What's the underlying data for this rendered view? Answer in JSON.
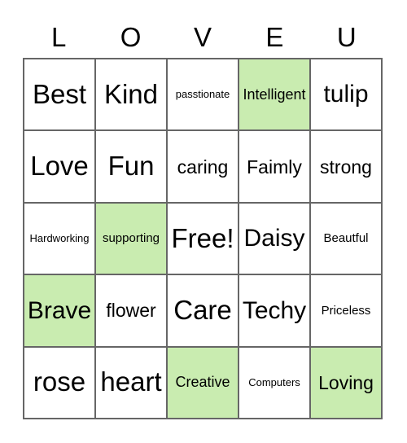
{
  "card": {
    "title_letters": [
      "L",
      "O",
      "V",
      "E",
      "U"
    ],
    "marked_color": "#c9ecb0",
    "grid_line_color": "#666666",
    "rows": [
      [
        {
          "text": "Best",
          "marked": false,
          "size": "sz-xl"
        },
        {
          "text": "Kind",
          "marked": false,
          "size": "sz-xl"
        },
        {
          "text": "passtionate",
          "marked": false,
          "size": "sz-xxs"
        },
        {
          "text": "Intelligent",
          "marked": true,
          "size": "sz-sm"
        },
        {
          "text": "tulip",
          "marked": false,
          "size": "sz-lg"
        }
      ],
      [
        {
          "text": "Love",
          "marked": false,
          "size": "sz-xl"
        },
        {
          "text": "Fun",
          "marked": false,
          "size": "sz-xl"
        },
        {
          "text": "caring",
          "marked": false,
          "size": "sz-md"
        },
        {
          "text": "Faimly",
          "marked": false,
          "size": "sz-md"
        },
        {
          "text": "strong",
          "marked": false,
          "size": "sz-md"
        }
      ],
      [
        {
          "text": "Hardworking",
          "marked": false,
          "size": "sz-xxs"
        },
        {
          "text": "supporting",
          "marked": true,
          "size": "sz-xs"
        },
        {
          "text": "Free!",
          "marked": false,
          "size": "sz-xl"
        },
        {
          "text": "Daisy",
          "marked": false,
          "size": "sz-lg"
        },
        {
          "text": "Beautful",
          "marked": false,
          "size": "sz-xs"
        }
      ],
      [
        {
          "text": "Brave",
          "marked": true,
          "size": "sz-lg"
        },
        {
          "text": "flower",
          "marked": false,
          "size": "sz-md"
        },
        {
          "text": "Care",
          "marked": false,
          "size": "sz-xl"
        },
        {
          "text": "Techy",
          "marked": false,
          "size": "sz-lg"
        },
        {
          "text": "Priceless",
          "marked": false,
          "size": "sz-xs"
        }
      ],
      [
        {
          "text": "rose",
          "marked": false,
          "size": "sz-xl"
        },
        {
          "text": "heart",
          "marked": false,
          "size": "sz-xl"
        },
        {
          "text": "Creative",
          "marked": true,
          "size": "sz-sm"
        },
        {
          "text": "Computers",
          "marked": false,
          "size": "sz-xxs"
        },
        {
          "text": "Loving",
          "marked": true,
          "size": "sz-md"
        }
      ]
    ]
  }
}
